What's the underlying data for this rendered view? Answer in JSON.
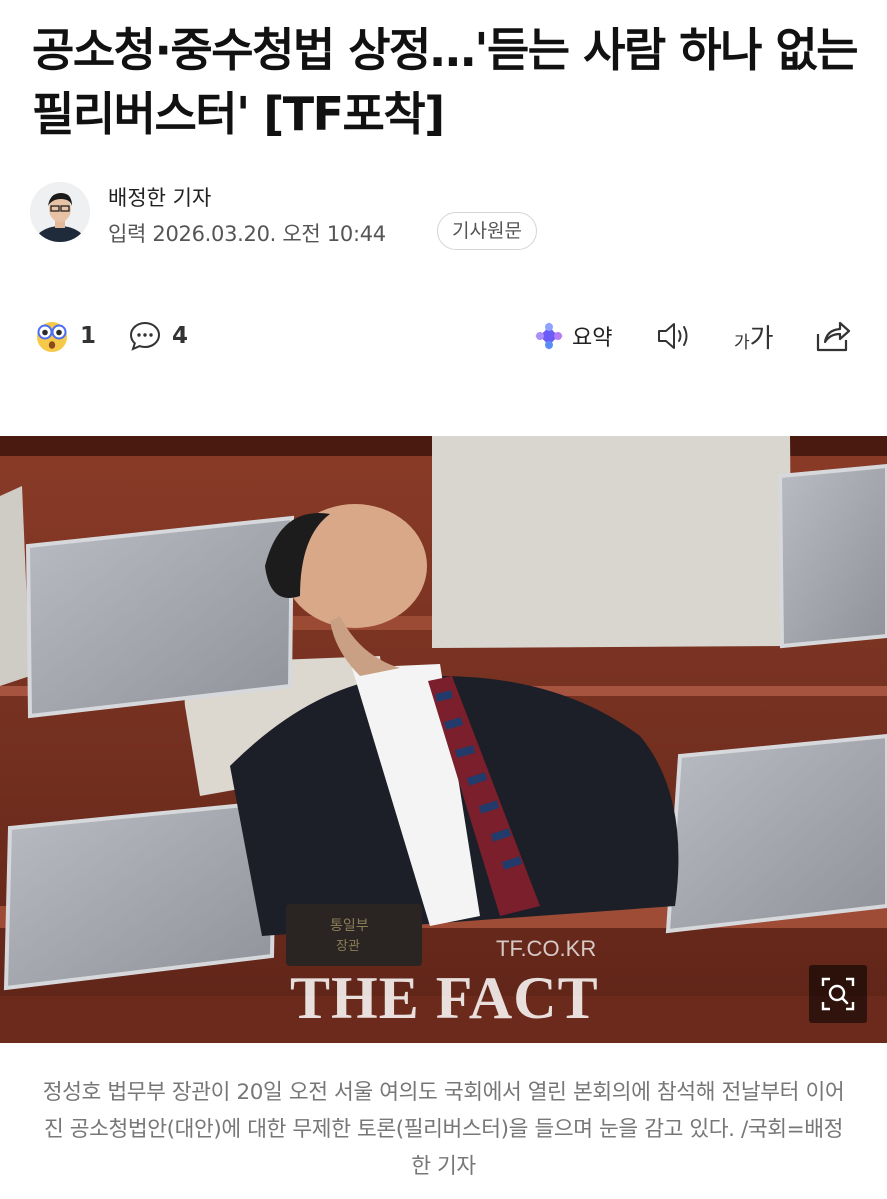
{
  "article": {
    "headline": "공소청·중수청법 상정…'듣는 사람 하나 없는 필리버스터' [TF포착]",
    "reporter": "배정한 기자",
    "published": "입력 2026.03.20. 오전 10:44",
    "original_button": "기사원문"
  },
  "toolbar": {
    "reaction_icon": "surprised-emoji-icon",
    "reaction_count": "1",
    "comment_icon": "comment-bubble-icon",
    "comment_count": "4",
    "summary_icon": "ai-sparkle-icon",
    "summary_label": "요약",
    "tts_icon": "speaker-icon",
    "font_size_label_small": "가",
    "font_size_label_large": "가",
    "share_icon": "share-icon"
  },
  "photo": {
    "watermark_site": "TF.CO.KR",
    "watermark_brand": "THE FACT",
    "nameplate_line1": "통일부",
    "nameplate_line2": "장관",
    "zoom_icon": "zoom-magnifier-icon"
  },
  "caption": "정성호 법무부 장관이 20일 오전 서울 여의도 국회에서 열린 본회의에 참석해 전날부터 이어진 공소청법안(대안)에 대한 무제한 토론(필리버스터)을 들으며 눈을 감고 있다. /국회=배정한 기자",
  "colors": {
    "accent_blue": "#4a6cf7",
    "emoji_yellow": "#f7c948",
    "caption_gray": "#777777",
    "wood": "#7a3424"
  }
}
